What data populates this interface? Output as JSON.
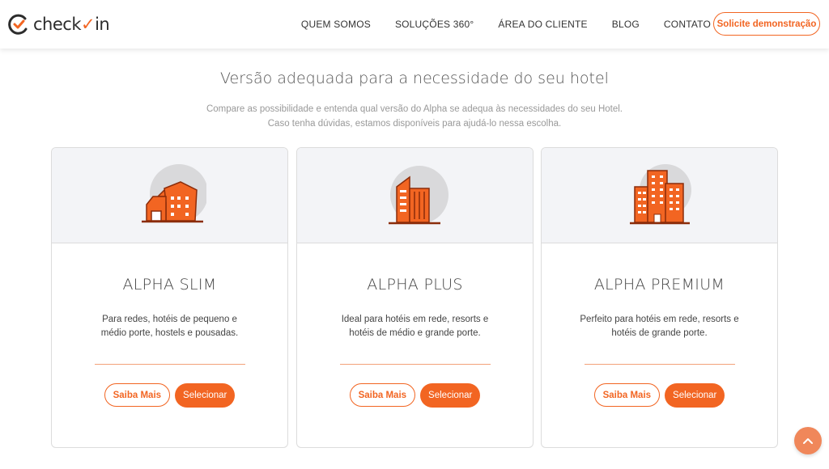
{
  "brand": {
    "name_prefix": "check",
    "name_suffix": "in",
    "accent": "#f26522"
  },
  "nav": {
    "items": [
      {
        "label": "QUEM SOMOS"
      },
      {
        "label": "SOLUÇÕES 360°"
      },
      {
        "label": "ÁREA DO CLIENTE"
      },
      {
        "label": "BLOG"
      },
      {
        "label": "CONTATO"
      }
    ],
    "cta_label": "Solicite demonstração"
  },
  "section": {
    "title": "Versão adequada para a necessidade do seu hotel",
    "subtitle": "Compare as possibilidade e entenda qual versão do Alpha se adequa às necessidades do seu Hotel. Caso tenha dúvidas, estamos disponíveis para ajudá-lo nessa escolha."
  },
  "cards": [
    {
      "icon": "small-hotel-icon",
      "name": "ALPHA SLIM",
      "description": "Para redes, hotéis de pequeno e médio porte, hostels e pousadas.",
      "more_label": "Saiba Mais",
      "select_label": "Selecionar"
    },
    {
      "icon": "tower-building-icon",
      "name": "ALPHA PLUS",
      "description": "Ideal para hotéis em rede, resorts e hotéis de médio e grande porte.",
      "more_label": "Saiba Mais",
      "select_label": "Selecionar"
    },
    {
      "icon": "large-hotel-icon",
      "name": "ALPHA PREMIUM",
      "description": "Perfeito para hotéis em rede, resorts e hotéis de grande porte.",
      "more_label": "Saiba Mais",
      "select_label": "Selecionar"
    }
  ],
  "scroll_top_icon": "chevron-up-icon"
}
